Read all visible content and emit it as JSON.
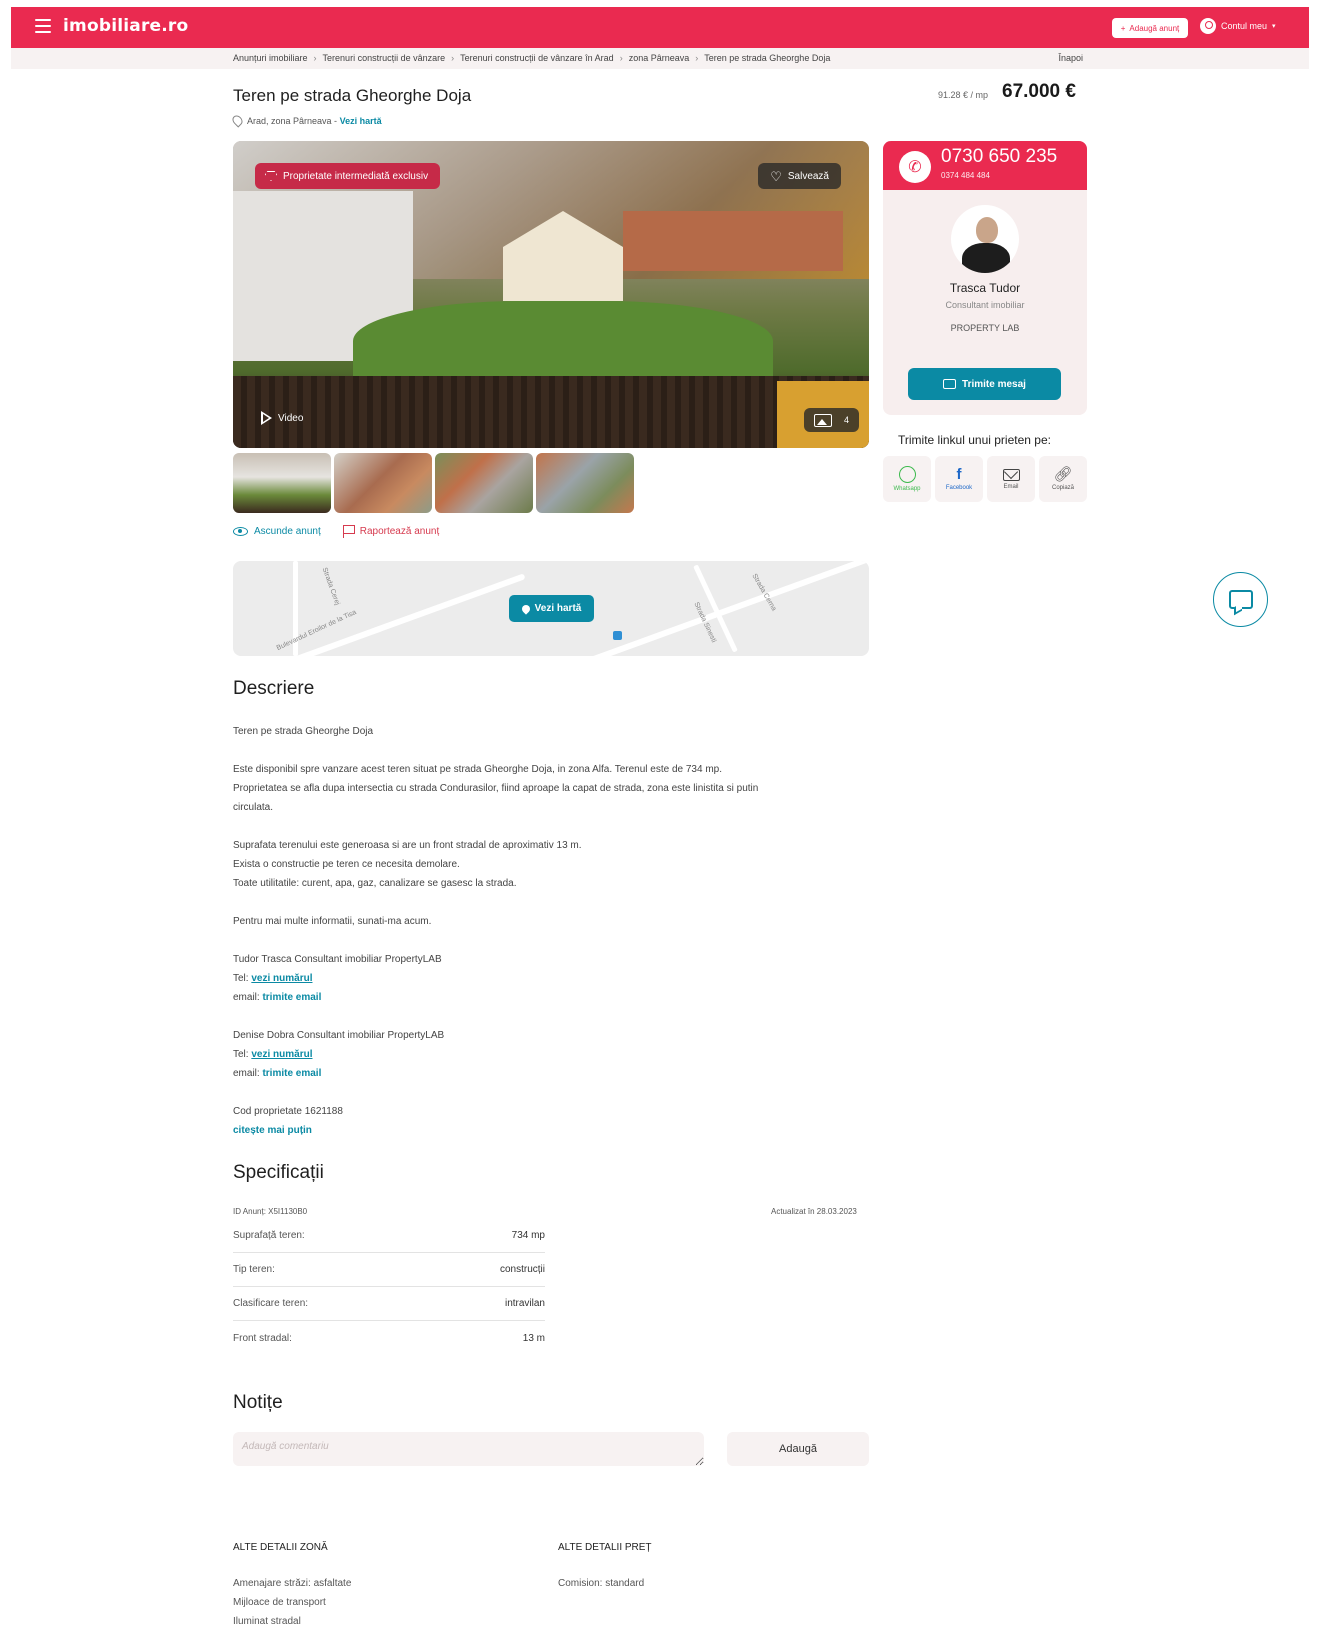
{
  "header": {
    "logo": "imobiliare.ro",
    "add_listing": "Adaugă anunț",
    "account": "Contul meu"
  },
  "breadcrumbs": [
    "Anunțuri imobiliare",
    "Terenuri construcții de vânzare",
    "Terenuri construcții de vânzare în Arad",
    "zona Pârneava",
    "Teren pe strada Gheorghe Doja"
  ],
  "back": "Înapoi",
  "listing": {
    "title": "Teren pe strada Gheorghe Doja",
    "location": "Arad, zona Pârneava - ",
    "map_link": "Vezi hartă",
    "price_per_mp": "91.28 € / mp",
    "price": "67.000 €",
    "badge": "Proprietate intermediată exclusiv",
    "save": "Salvează",
    "video": "Video",
    "photo_count": "4",
    "hide": "Ascunde anunț",
    "report": "Raportează anunț"
  },
  "map": {
    "button": "Vezi hartă",
    "streets": [
      "Strada Cerej",
      "Bulevardul Eroilor de la Tisa",
      "Strada Cerna",
      "Strada Sinesti"
    ]
  },
  "agent": {
    "phone": "0730 650 235",
    "phone2": "0374 484 484",
    "name": "Trasca Tudor",
    "role": "Consultant imobiliar",
    "agency": "PROPERTY LAB",
    "message": "Trimite mesaj"
  },
  "share": {
    "title": "Trimite linkul unui prieten pe:",
    "items": [
      "Whatsapp",
      "Facebook",
      "Email",
      "Copiază"
    ]
  },
  "description": {
    "heading": "Descriere",
    "p1": "Teren pe strada Gheorghe Doja",
    "p2_l1": "Este disponibil spre vanzare acest teren situat pe strada Gheorghe Doja, in zona Alfa. Terenul este de 734 mp.",
    "p2_l2": "Proprietatea se afla dupa intersectia cu strada Condurasilor, fiind aproape la capat de strada, zona este linistita si putin",
    "p2_l3": "circulata.",
    "p3_l1": "Suprafata terenului este generoasa si are un front stradal de aproximativ 13 m.",
    "p3_l2": "Exista o constructie pe teren ce necesita demolare.",
    "p3_l3": "Toate utilitatile: curent, apa, gaz, canalizare se gasesc la strada.",
    "p4": "Pentru mai multe informatii, sunati-ma acum.",
    "c1_name": "Tudor Trasca Consultant imobiliar PropertyLAB",
    "c2_name": "Denise Dobra Consultant imobiliar PropertyLAB",
    "tel_label": "Tel: ",
    "tel_link": "vezi numărul",
    "email_label": "email: ",
    "email_link": "trimite email",
    "code": "Cod proprietate 1621188",
    "read_less": "citește mai puțin"
  },
  "specs": {
    "heading": "Specificații",
    "id": "ID Anunț: X5I1130B0",
    "updated": "Actualizat în 28.03.2023",
    "rows": [
      {
        "k": "Suprafață teren:",
        "v": "734 mp"
      },
      {
        "k": "Tip teren:",
        "v": "construcții"
      },
      {
        "k": "Clasificare teren:",
        "v": "intravilan"
      },
      {
        "k": "Front stradal:",
        "v": "13 m"
      }
    ]
  },
  "notes": {
    "heading": "Notițe",
    "placeholder": "Adaugă comentariu",
    "add": "Adaugă"
  },
  "details": {
    "zone_heading": "ALTE DETALII ZONĂ",
    "zone_items": [
      "Amenajare străzi: asfaltate",
      "Mijloace de transport",
      "Iluminat stradal"
    ],
    "price_heading": "ALTE DETALII PREȚ",
    "price_items": [
      "Comision: standard"
    ]
  },
  "colors": {
    "brand": "#ea2a50",
    "accent": "#0b8aa4"
  }
}
